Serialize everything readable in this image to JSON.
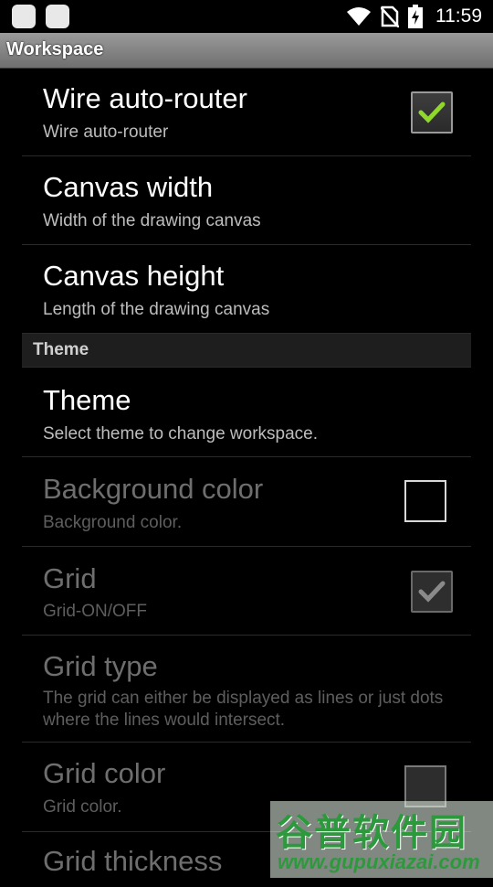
{
  "status_bar": {
    "time": "11:59",
    "icons": [
      "app-icon",
      "app-icon",
      "wifi-icon",
      "no-sim-icon",
      "battery-charging-icon"
    ]
  },
  "title_bar": {
    "title": "Workspace"
  },
  "preferences": [
    {
      "title": "Wire auto-router",
      "summary": "Wire auto-router",
      "enabled": true,
      "checkbox": "checked"
    },
    {
      "title": "Canvas width",
      "summary": "Width of the drawing canvas",
      "enabled": true
    },
    {
      "title": "Canvas height",
      "summary": "Length of the drawing canvas",
      "enabled": true
    }
  ],
  "category": {
    "label": "Theme"
  },
  "theme_preferences": [
    {
      "title": "Theme",
      "summary": "Select theme to change workspace.",
      "enabled": true
    },
    {
      "title": "Background color",
      "summary": "Background color.",
      "enabled": false,
      "swatch": "empty"
    },
    {
      "title": "Grid",
      "summary": "Grid-ON/OFF",
      "enabled": false,
      "checkbox": "checked"
    },
    {
      "title": "Grid type",
      "summary": "The grid can either be displayed as lines or just dots where the lines would intersect.",
      "enabled": false
    },
    {
      "title": "Grid color",
      "summary": "Grid color.",
      "enabled": false,
      "swatch": "filled"
    },
    {
      "title": "Grid thickness",
      "summary": "",
      "enabled": false
    }
  ],
  "watermark": {
    "chinese": "谷普软件园",
    "url": "www.gupuxiazai.com"
  },
  "colors": {
    "check_green": "#8fd82a",
    "title_bar": "#8a8a8a",
    "category_bg": "#1e1e1e"
  }
}
